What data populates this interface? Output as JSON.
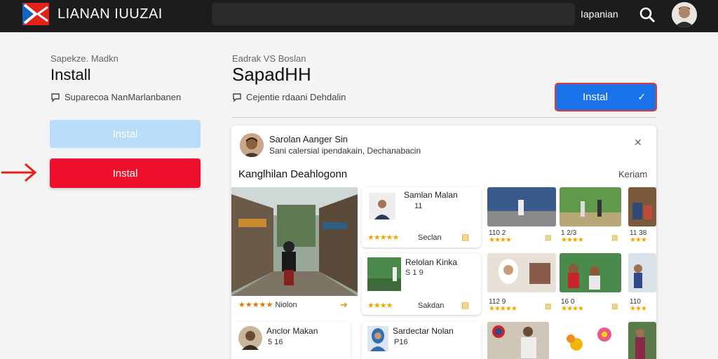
{
  "header": {
    "brand": "LIANAN IUUZAI",
    "nav_link": "Iapanian"
  },
  "left": {
    "subtitle": "Sapekze. Madkn",
    "title": "Install",
    "note": "Suparecoa NanMarlanbanen",
    "light_button": "Instal",
    "red_button": "Instal"
  },
  "right": {
    "subtitle": "Eadrak VS Boslan",
    "title": "SapadHH",
    "note": "Cejentie rdaani Dehdalin",
    "blue_button": "Instal"
  },
  "panel": {
    "author_name": "Sarolan Aanger Sin",
    "author_desc": "Sani calersial ipendakain, Dechanabacin",
    "heading": "Kanglhilan Deahlogonn",
    "more": "Keriam",
    "featured": {
      "stars_text": "★★★★★",
      "label": "Niolon"
    },
    "cards": [
      {
        "title": "Samlan Malan",
        "meta": "11",
        "label": "Seclan"
      },
      {
        "title": "Relolan Kinka",
        "meta": "S 1 9",
        "label": "Sakdan"
      },
      {
        "title": "Anclor Makan",
        "meta": "5 16",
        "label": ""
      },
      {
        "title": "Sardectar Nolan",
        "meta": "P16",
        "label": ""
      }
    ],
    "tiles": [
      {
        "num": "110 2"
      },
      {
        "num": "1 2/3"
      },
      {
        "num": "11 38"
      },
      {
        "num": "112 9"
      },
      {
        "num": "16 0"
      },
      {
        "num": "110"
      }
    ]
  },
  "colors": {
    "topbar": "#1c1c1c",
    "red_button": "#ee0f2c",
    "light_button": "#b9dcf9",
    "blue_button": "#1a73e8",
    "arrow": "#e32119",
    "star": "#f2a500"
  },
  "icons": [
    "logo-icon",
    "search-icon",
    "user-avatar",
    "speech-bubble-icon",
    "red-arrow-icon",
    "chevron-down-icon",
    "close-icon",
    "star-icon"
  ]
}
